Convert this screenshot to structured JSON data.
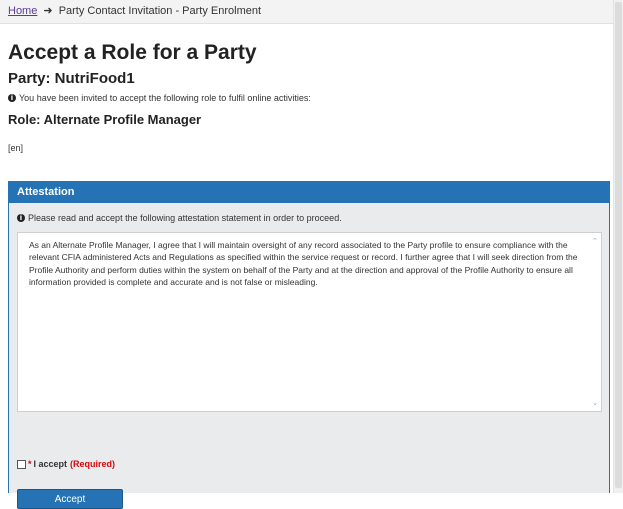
{
  "breadcrumb": {
    "home": "Home",
    "separator": "➜",
    "current": "Party Contact Invitation - Party Enrolment"
  },
  "page_title": "Accept a Role for a Party",
  "party_heading": "Party: NutriFood1",
  "invite_info": "You have been invited to accept the following role to fulfil online activities:",
  "role_heading": "Role: Alternate Profile Manager",
  "lang_tag": "[en]",
  "attestation": {
    "title": "Attestation",
    "instruction": "Please read and accept the following attestation statement in order to proceed.",
    "statement": "As an Alternate Profile Manager, I agree that I will maintain oversight of any record associated to the Party profile to ensure compliance with the relevant CFIA administered Acts and Regulations as specified within the service request or record. I further agree that I will seek direction from the Profile Authority and perform duties within the system on behalf of the Party and at the direction and approval of the Profile Authority to ensure all information provided is complete and accurate and is not false or misleading.",
    "checkbox_asterisk": "*",
    "checkbox_label": "I accept",
    "required_label": "(Required)",
    "accept_button": "Accept"
  },
  "icons": {
    "info": "info-circle-icon",
    "scroll_up": "chevron-up-icon",
    "scroll_down": "chevron-down-icon"
  },
  "colors": {
    "panel_header": "#2572b4",
    "required": "#d3080c",
    "link": "#5b3c8f"
  }
}
